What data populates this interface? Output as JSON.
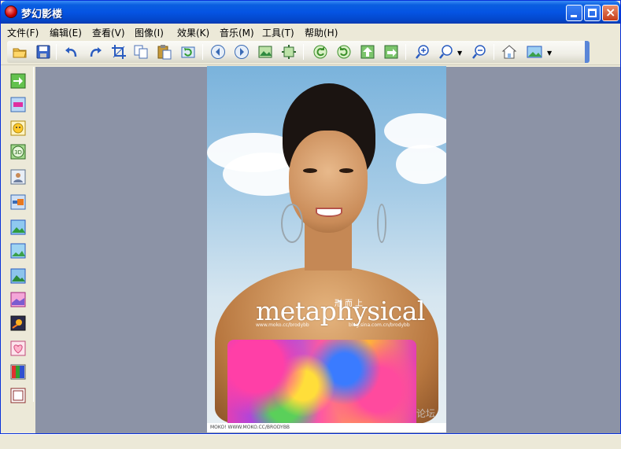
{
  "window": {
    "title": "梦幻影楼"
  },
  "menu": {
    "items": [
      "文件(F)",
      "编辑(E)",
      "查看(V)",
      "图像(I)",
      "效果(K)",
      "音乐(M)",
      "工具(T)",
      "帮助(H)"
    ]
  },
  "toolbar": {
    "buttons": [
      "open-folder-icon",
      "save-icon",
      "undo-icon",
      "redo-icon",
      "crop-icon",
      "copy-icon",
      "paste-icon",
      "refresh-icon",
      "previous-icon",
      "next-icon",
      "fit-image-icon",
      "actual-size-icon",
      "rotate-left-icon",
      "rotate-right-icon",
      "move-up-icon",
      "export-icon",
      "zoom-in-icon",
      "zoom-dropdown-icon",
      "zoom-out-icon",
      "home-icon",
      "wallpaper-icon"
    ]
  },
  "sidebar": {
    "buttons": [
      "go-icon",
      "transition-icon",
      "smiley-icon",
      "3d-icon",
      "portrait-icon",
      "frame-icon",
      "landscape-icon",
      "landscape-alt-icon",
      "scenery-icon",
      "heart-scene-icon",
      "star-burst-icon",
      "heart-icon",
      "color-bars-icon",
      "film-icon"
    ],
    "glyph_3d": "3D"
  },
  "image": {
    "watermark_main": "metaphysical",
    "watermark_cn": "形而上",
    "watermark_url_left": "www.moko.cc/brodybb",
    "watermark_url_right": "blog.sina.com.cn/brodybb",
    "forum_mark": "论坛",
    "footer_caption": "MOKO! WWW.MOKO.CC/BRODYBB"
  },
  "colors": {
    "titlebar_blue": "#0554e3",
    "canvas_gray": "#8c93a6",
    "chrome": "#ece9d8"
  }
}
